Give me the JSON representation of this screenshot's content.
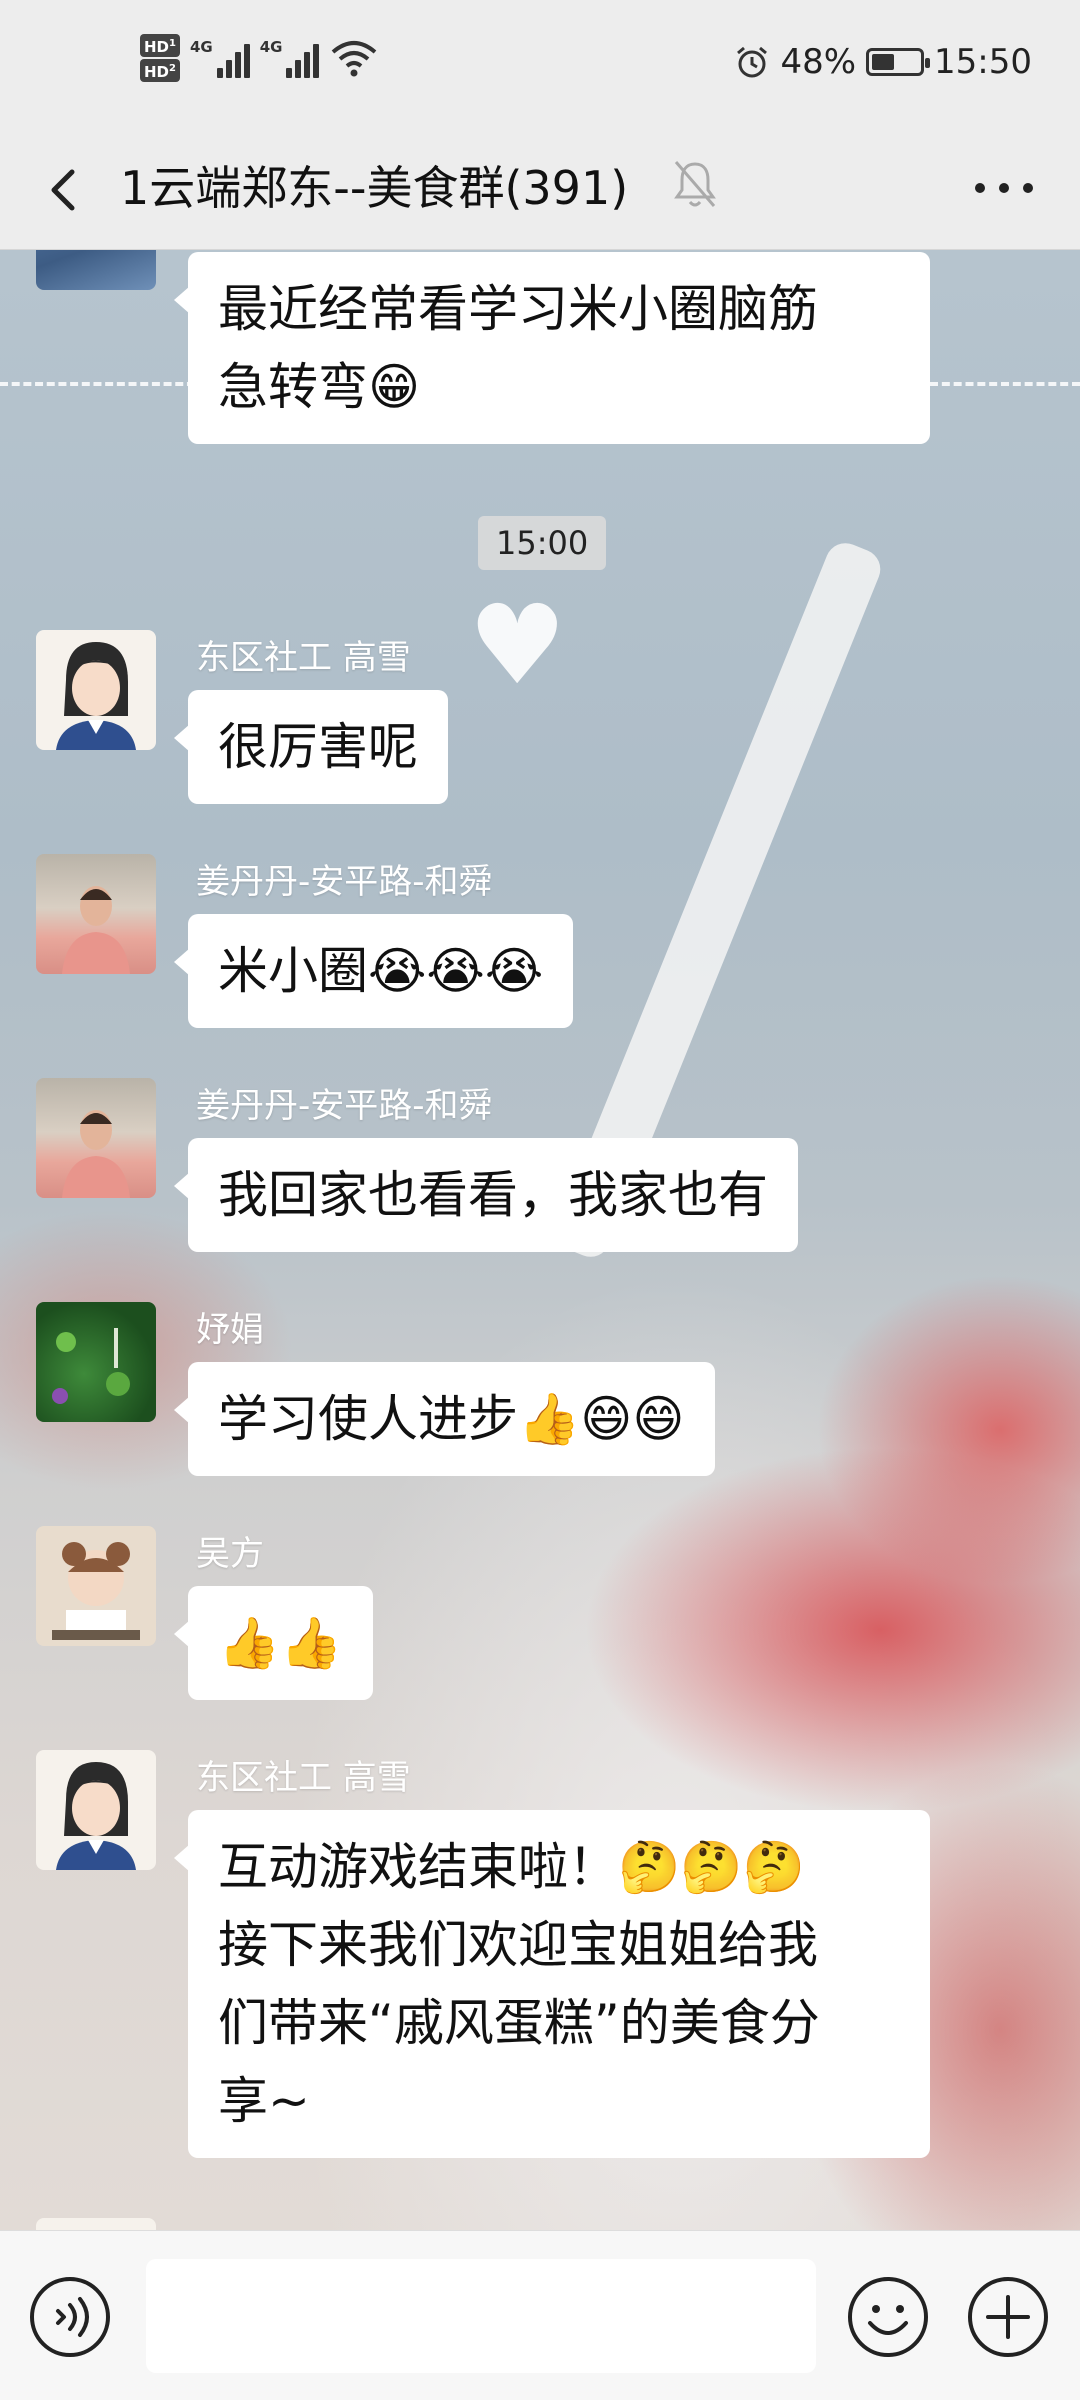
{
  "status_bar": {
    "hd1": "HD",
    "hd2": "HD",
    "sim1": "1",
    "sim2": "2",
    "net1": "4G",
    "net2": "4G",
    "battery_text": "48%",
    "battery_level": 0.48,
    "time": "15:50"
  },
  "header": {
    "title": "1云端郑东--美食群(391)",
    "back_icon": "chevron-left-icon",
    "mute_icon": "bell-off-icon",
    "more_icon": "more-dots-icon"
  },
  "messages": [
    {
      "sender": "",
      "text_lines": [
        "最近经常看学习米小圈脑筋",
        "急转弯😁"
      ]
    },
    {
      "sender": "东区社工 高雪",
      "text_lines": [
        "很厉害呢"
      ]
    },
    {
      "sender": "姜丹丹-安平路-和舜",
      "text_lines": [
        "米小圈😭😭😭"
      ]
    },
    {
      "sender": "姜丹丹-安平路-和舜",
      "text_lines": [
        "我回家也看看，我家也有"
      ]
    },
    {
      "sender": "妤娟",
      "text_lines": [
        "学习使人进步👍😄😄"
      ]
    },
    {
      "sender": "吴方",
      "text_lines": [
        "👍👍"
      ]
    },
    {
      "sender": "东区社工 高雪",
      "text_lines": [
        "互动游戏结束啦！🤔🤔🤔",
        "接下来我们欢迎宝姐姐给我",
        "们带来“戚风蛋糕”的美食分",
        "享~"
      ]
    }
  ],
  "timestamp": "15:00",
  "input_bar": {
    "voice_icon": "voice-icon",
    "input_value": "",
    "emoji_icon": "emoji-icon",
    "plus_icon": "plus-icon"
  }
}
